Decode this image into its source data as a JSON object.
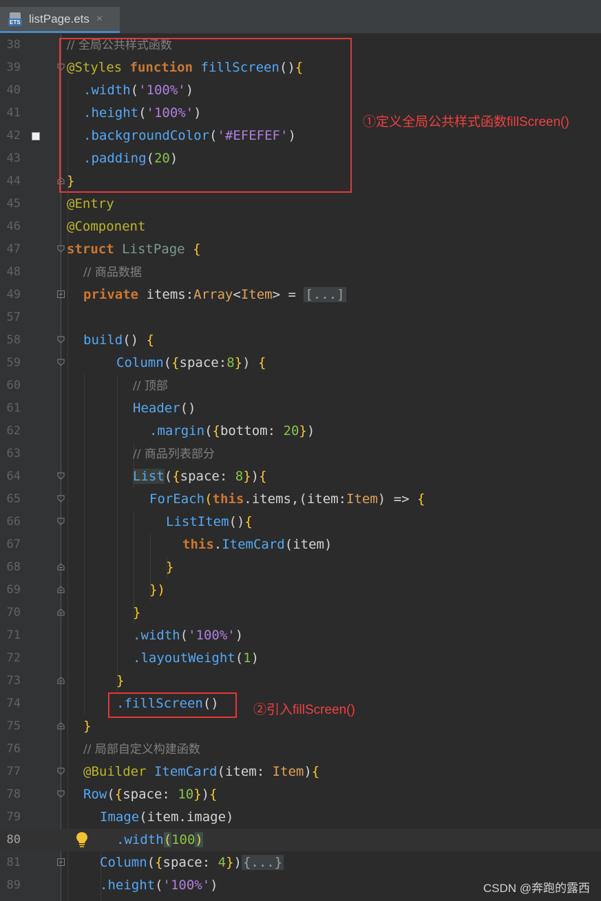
{
  "editor": {
    "tab": {
      "title": "listPage.ets",
      "icon": "ets-file-icon",
      "close": "×"
    },
    "lines": [
      {
        "num": "38"
      },
      {
        "num": "39"
      },
      {
        "num": "40"
      },
      {
        "num": "41"
      },
      {
        "num": "42"
      },
      {
        "num": "43"
      },
      {
        "num": "44"
      },
      {
        "num": "45"
      },
      {
        "num": "46"
      },
      {
        "num": "47"
      },
      {
        "num": "48"
      },
      {
        "num": "49"
      },
      {
        "num": "57"
      },
      {
        "num": "58"
      },
      {
        "num": "59"
      },
      {
        "num": "60"
      },
      {
        "num": "61"
      },
      {
        "num": "62"
      },
      {
        "num": "63"
      },
      {
        "num": "64"
      },
      {
        "num": "65"
      },
      {
        "num": "66"
      },
      {
        "num": "67"
      },
      {
        "num": "68"
      },
      {
        "num": "69"
      },
      {
        "num": "70"
      },
      {
        "num": "71"
      },
      {
        "num": "72"
      },
      {
        "num": "73"
      },
      {
        "num": "74"
      },
      {
        "num": "75"
      },
      {
        "num": "76"
      },
      {
        "num": "77"
      },
      {
        "num": "78"
      },
      {
        "num": "79"
      },
      {
        "num": "80"
      },
      {
        "num": "81"
      },
      {
        "num": "89"
      }
    ],
    "current_line": "80",
    "colors": {
      "background": "#2b2b2b",
      "keyword": "#cc7832",
      "method": "#56a8f5",
      "string": "#b07fe0",
      "number": "#8bc34a",
      "comment": "#808080",
      "annotation": "#bbb529",
      "annotation_box": "#e53935"
    }
  },
  "code": {
    "l38": "// 全局公共样式函数",
    "l39": [
      "@Styles",
      " ",
      "function",
      " ",
      "fillScreen",
      "()",
      "{"
    ],
    "l40": [
      ".width",
      "(",
      "'100%'",
      ")"
    ],
    "l41": [
      ".height",
      "(",
      "'100%'",
      ")"
    ],
    "l42": [
      ".backgroundColor",
      "(",
      "'#EFEFEF'",
      ")"
    ],
    "l43": [
      ".padding",
      "(",
      "20",
      ")"
    ],
    "l44": "}",
    "l45": "@Entry",
    "l46": "@Component",
    "l47": [
      "struct",
      " ",
      "ListPage",
      " ",
      "{"
    ],
    "l48": "// 商品数据",
    "l49": [
      "private",
      " items:",
      "Array",
      "<",
      "Item",
      "> = ",
      "[...]"
    ],
    "l58": [
      "build",
      "() ",
      "{"
    ],
    "l59": [
      "Column",
      "(",
      "{",
      "space:",
      "8",
      "}",
      ") ",
      "{"
    ],
    "l60": "// 顶部",
    "l61": [
      "Header",
      "()"
    ],
    "l62": [
      ".margin",
      "(",
      "{",
      "bottom: ",
      "20",
      "}",
      ")"
    ],
    "l63": "// 商品列表部分",
    "l64": [
      "List",
      "(",
      "{",
      "space: ",
      "8",
      "}",
      ")",
      "{"
    ],
    "l65": [
      "ForEach",
      "(",
      "this",
      ".items,",
      "(",
      "item:",
      "Item",
      ") ",
      "=> ",
      "{"
    ],
    "l66": [
      "ListItem",
      "()",
      "{"
    ],
    "l67": [
      "this",
      ".",
      "ItemCard",
      "(",
      "item",
      ")"
    ],
    "l68": "}",
    "l69": "})",
    "l70": "}",
    "l71": [
      ".width",
      "(",
      "'100%'",
      ")"
    ],
    "l72": [
      ".layoutWeight",
      "(",
      "1",
      ")"
    ],
    "l73": "}",
    "l74": [
      ".fillScreen",
      "()"
    ],
    "l75": "}",
    "l76": "// 局部自定义构建函数",
    "l77": [
      "@Builder",
      " ",
      "ItemCard",
      "(",
      "item: ",
      "Item",
      ")",
      "{"
    ],
    "l78": [
      "Row",
      "(",
      "{",
      "space: ",
      "10",
      "}",
      ")",
      "{"
    ],
    "l79": [
      "Image",
      "(",
      "item.image",
      ")"
    ],
    "l80": [
      ".width",
      "(",
      "100",
      ")"
    ],
    "l81": [
      "Column",
      "(",
      "{",
      "space: ",
      "4",
      "}",
      ")",
      "{...}"
    ],
    "l89": [
      ".height",
      "(",
      "'100%'",
      ")"
    ]
  },
  "annotations": {
    "note1": "①定义全局公共样式函数fillScreen()",
    "note2": "②引入fillScreen()"
  },
  "watermark": "CSDN @奔跑的露西"
}
